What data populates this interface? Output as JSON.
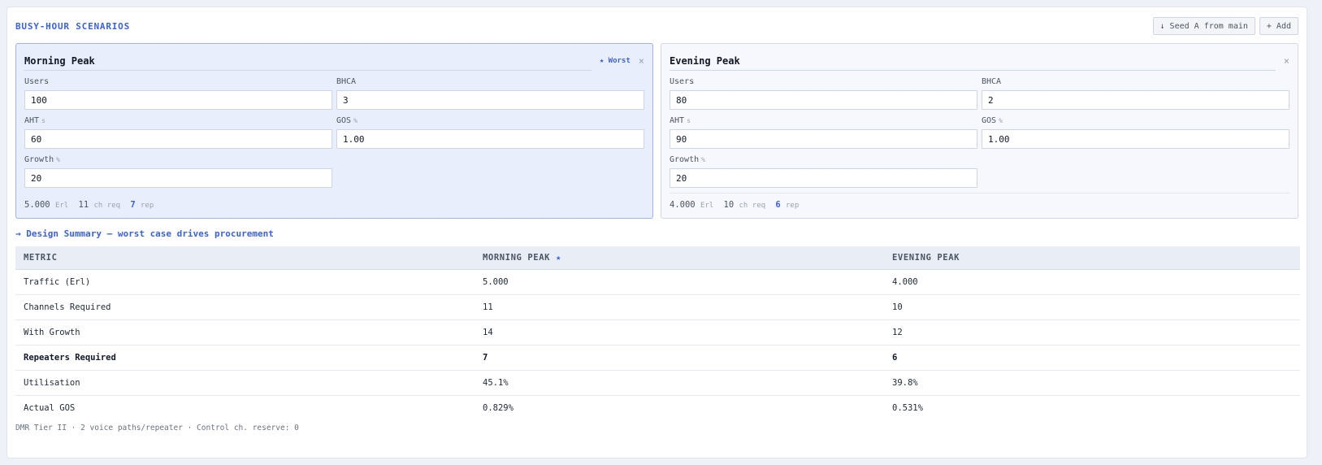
{
  "section_title": "BUSY-HOUR SCENARIOS",
  "actions": {
    "seed_label": "↓ Seed A from main",
    "add_label": "+ Add"
  },
  "scenarios": [
    {
      "name": "Morning Peak",
      "worst_badge": "★ Worst",
      "close": "×",
      "users_label": "Users",
      "users": "100",
      "bhca_label": "BHCA",
      "bhca": "3",
      "aht_label": "AHT",
      "aht_unit": "s",
      "aht": "60",
      "gos_label": "GOS",
      "gos_unit": "%",
      "gos": "1.00",
      "growth_label": "Growth",
      "growth_unit": "%",
      "growth": "20",
      "erl": "5.000",
      "erl_label": "Erl",
      "ch": "11",
      "ch_label": "ch req",
      "rep": "7",
      "rep_label": "rep"
    },
    {
      "name": "Evening Peak",
      "close": "×",
      "users_label": "Users",
      "users": "80",
      "bhca_label": "BHCA",
      "bhca": "2",
      "aht_label": "AHT",
      "aht_unit": "s",
      "aht": "90",
      "gos_label": "GOS",
      "gos_unit": "%",
      "gos": "1.00",
      "growth_label": "Growth",
      "growth_unit": "%",
      "growth": "20",
      "erl": "4.000",
      "erl_label": "Erl",
      "ch": "10",
      "ch_label": "ch req",
      "rep": "6",
      "rep_label": "rep"
    }
  ],
  "summary": {
    "title": "→ Design Summary — worst case drives procurement",
    "headers": [
      "METRIC",
      "MORNING PEAK",
      "EVENING PEAK"
    ],
    "worst_star": "★",
    "rows": [
      [
        "Traffic (Erl)",
        "5.000",
        "4.000"
      ],
      [
        "Channels Required",
        "11",
        "10"
      ],
      [
        "With Growth",
        "14",
        "12"
      ],
      [
        "Repeaters Required",
        "7",
        "6"
      ],
      [
        "Utilisation",
        "45.1%",
        "39.8%"
      ],
      [
        "Actual GOS",
        "0.829%",
        "0.531%"
      ]
    ]
  },
  "footer": "DMR Tier II · 2 voice paths/repeater · Control ch. reserve: 0"
}
